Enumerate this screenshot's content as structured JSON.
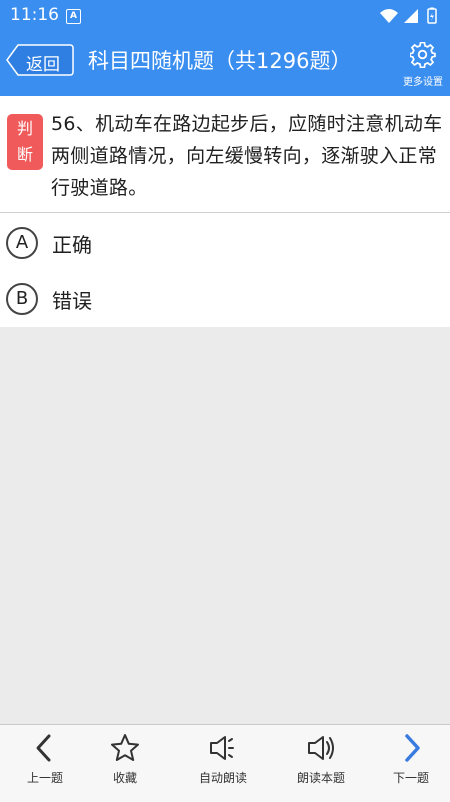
{
  "status_bar": {
    "time": "11:16",
    "notification_letter": "A"
  },
  "header": {
    "back_label": "返回",
    "title": "科目四随机题（共1296题）",
    "settings_label": "更多设置"
  },
  "question": {
    "type_label": [
      "判",
      "断"
    ],
    "text": "56、机动车在路边起步后，应随时注意机动车两侧道路情况，向左缓慢转向，逐渐驶入正常行驶道路。"
  },
  "options": [
    {
      "letter": "A",
      "text": "正确"
    },
    {
      "letter": "B",
      "text": "错误"
    }
  ],
  "bottom_nav": [
    {
      "label": "上一题",
      "icon": "chevron-left-icon"
    },
    {
      "label": "收藏",
      "icon": "star-icon"
    },
    {
      "label": "自动朗读",
      "icon": "speaker-auto-icon"
    },
    {
      "label": "朗读本题",
      "icon": "speaker-icon"
    },
    {
      "label": "下一题",
      "icon": "chevron-right-icon"
    }
  ],
  "colors": {
    "primary": "#3a8ef0",
    "badge": "#f15a5a",
    "next_accent": "#3a7be0"
  }
}
